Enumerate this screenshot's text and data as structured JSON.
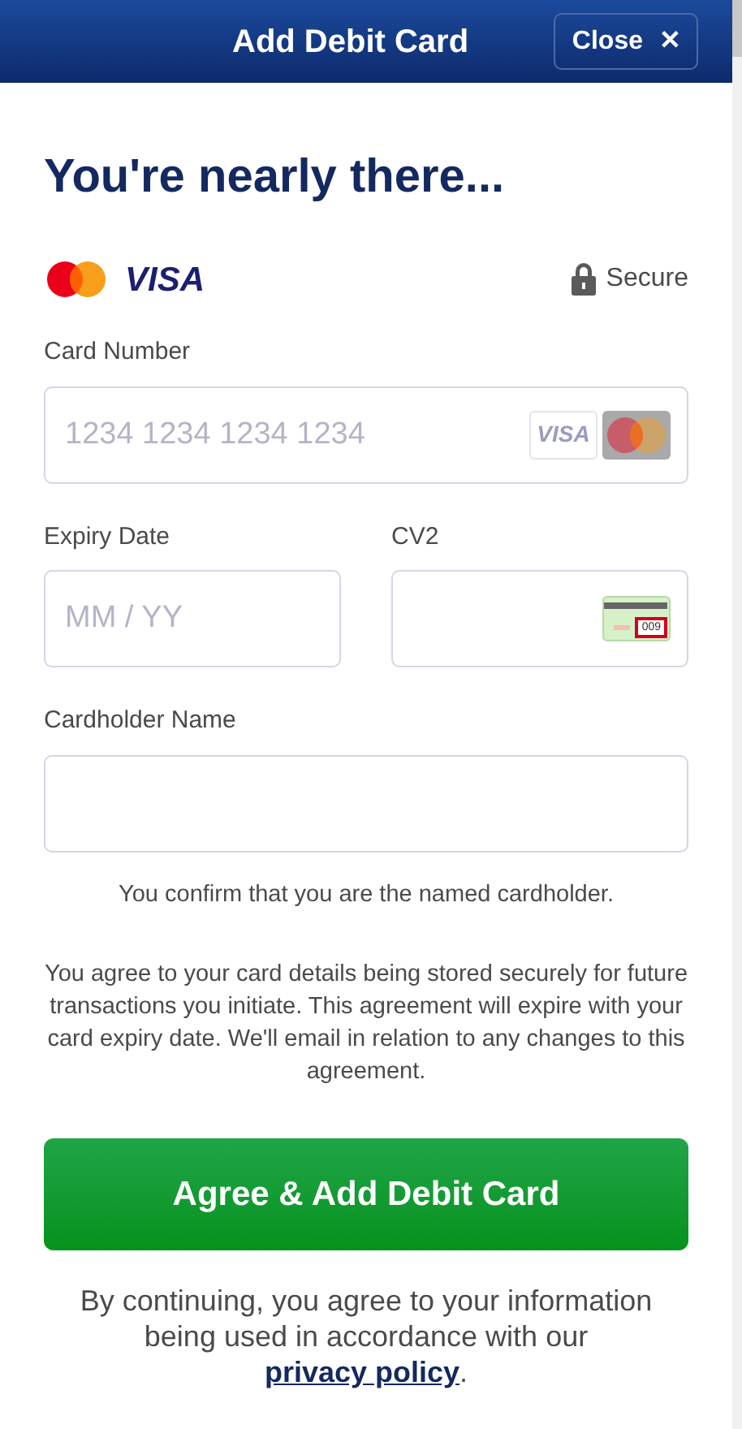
{
  "header": {
    "title": "Add Debit Card",
    "close_button": "Close",
    "close_icon": "✕"
  },
  "heading": "You're nearly there...",
  "brands": {
    "visa": "VISA",
    "secure": "Secure"
  },
  "fields": [
    {
      "kind": "card",
      "label": "Card Number",
      "placeholder": "1234 1234 1234 1234",
      "visa": "VISA"
    },
    {
      "kind": "plain",
      "label": "Expiry Date",
      "placeholder": "MM / YY"
    },
    {
      "kind": "cvv",
      "label": "CV2",
      "cvv_sample": "009"
    },
    {
      "kind": "plain",
      "label": "Cardholder Name"
    }
  ],
  "confirm_note": "You confirm that you are the named cardholder.",
  "agreement": "You agree to your card details being stored securely for future transactions you initiate. This agreement will expire with your card expiry date. We'll email in relation to any changes to this agreement.",
  "submit_button": "Agree & Add Debit Card",
  "footer": {
    "text": "By continuing, you agree to your information being used in accordance with our",
    "link": "privacy policy",
    "end": "."
  }
}
